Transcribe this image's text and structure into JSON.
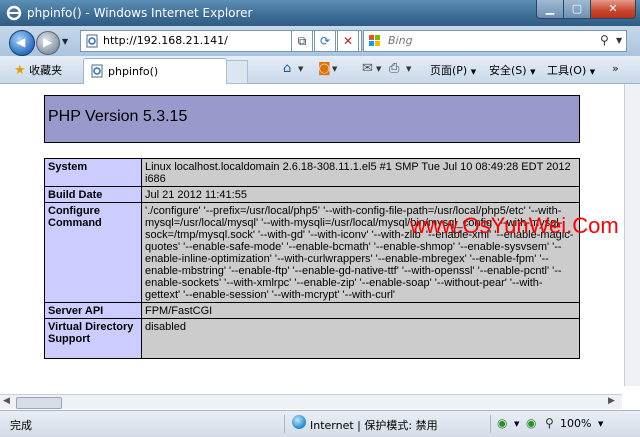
{
  "window": {
    "title": "phpinfo() - Windows Internet Explorer",
    "minimize_glyph": "▁",
    "maximize_glyph": "▢",
    "close_glyph": "✕"
  },
  "nav": {
    "address": "http://192.168.21.141/",
    "search_placeholder": "Bing"
  },
  "command_bar": {
    "favorites_label": "收藏夹",
    "tab_title": "phpinfo()",
    "page_menu": "页面(P)",
    "safety_menu": "安全(S)",
    "tools_menu": "工具(O)"
  },
  "page": {
    "php_version": "PHP Version 5.3.15",
    "rows": [
      {
        "key": "System",
        "value": "Linux localhost.localdomain 2.6.18-308.11.1.el5 #1 SMP Tue Jul 10 08:49:28 EDT 2012 i686"
      },
      {
        "key": "Build Date",
        "value": "Jul 21 2012 11:41:55"
      },
      {
        "key": "Configure Command",
        "value": "'./configure' '--prefix=/usr/local/php5' '--with-config-file-path=/usr/local/php5/etc' '--with-mysql=/usr/local/mysql' '--with-mysqli=/usr/local/mysql/bin/mysql_config' '--with-mysql-sock=/tmp/mysql.sock' '--with-gd' '--with-iconv' '--with-zlib' '--enable-xml' '--enable-magic-quotes' '--enable-safe-mode' '--enable-bcmath' '--enable-shmop' '--enable-sysvsem' '--enable-inline-optimization' '--with-curlwrappers' '--enable-mbregex' '--enable-fpm' '--enable-mbstring' '--enable-ftp' '--enable-gd-native-ttf' '--with-openssl' '--enable-pcntl' '--enable-sockets' '--with-xmlrpc' '--enable-zip' '--enable-soap' '--without-pear' '--with-gettext' '--enable-session' '--with-mcrypt' '--with-curl'"
      },
      {
        "key": "Server API",
        "value": "FPM/FastCGI"
      },
      {
        "key": "Virtual Directory Support",
        "value": "disabled"
      }
    ]
  },
  "watermark": "www.OsYunWei.Com",
  "status": {
    "left_text": "完成",
    "zone_text": "Internet | 保护模式: 禁用",
    "zoom_text": "100%"
  }
}
